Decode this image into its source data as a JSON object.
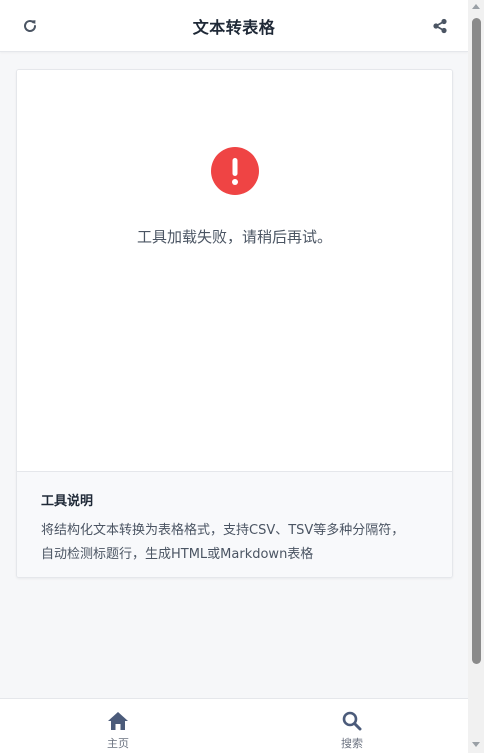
{
  "header": {
    "title": "文本转表格",
    "refresh_icon": "refresh-icon",
    "share_icon": "share-icon"
  },
  "error": {
    "icon": "exclamation-circle-icon",
    "message": "工具加载失败，请稍后再试。"
  },
  "description": {
    "title": "工具说明",
    "text": "将结构化文本转换为表格格式，支持CSV、TSV等多种分隔符，自动检测标题行，生成HTML或Markdown表格"
  },
  "bottom_nav": {
    "items": [
      {
        "label": "主页",
        "icon": "home-icon"
      },
      {
        "label": "搜索",
        "icon": "search-icon"
      }
    ]
  },
  "colors": {
    "error": "#ef4444",
    "icon": "#4b5563",
    "nav_icon": "#4b5b7a"
  }
}
